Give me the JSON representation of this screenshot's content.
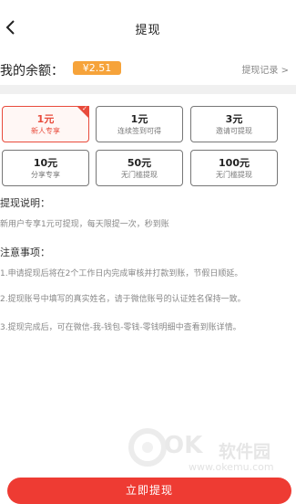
{
  "header": {
    "title": "提现"
  },
  "balance": {
    "label": "我的余额：",
    "amount": "¥2.51",
    "record_link": "提现记录 >"
  },
  "amounts": [
    {
      "value": "1元",
      "desc": "新人专享",
      "selected": true
    },
    {
      "value": "1元",
      "desc": "连续签到可得",
      "selected": false
    },
    {
      "value": "3元",
      "desc": "邀请可提现",
      "selected": false
    },
    {
      "value": "10元",
      "desc": "分享专享",
      "selected": false
    },
    {
      "value": "50元",
      "desc": "无门槛提现",
      "selected": false
    },
    {
      "value": "100元",
      "desc": "无门槛提现",
      "selected": false
    }
  ],
  "instructions": {
    "title": "提现说明：",
    "text": "新用户专享1元可提现，每天限提一次，秒到账"
  },
  "notes": {
    "title": "注意事项：",
    "items": [
      "1.申请提现后将在2个工作日内完成审核并打款到账，节假日顺延。",
      "2.提现账号中填写的真实姓名，请于微信账号的认证姓名保持一致。",
      "3.提现完成后，可在微信-我-钱包-零钱-零钱明细中查看到账详情。"
    ]
  },
  "footer": {
    "button_label": "立即提现"
  },
  "watermark": {
    "brand_letters": "OK",
    "name": "软件园",
    "url": "www.okemu.com"
  },
  "colors": {
    "accent": "#ee3b33",
    "badge": "#f6a33a"
  },
  "icons": {
    "back": "back-arrow-icon",
    "check": "check-icon"
  }
}
